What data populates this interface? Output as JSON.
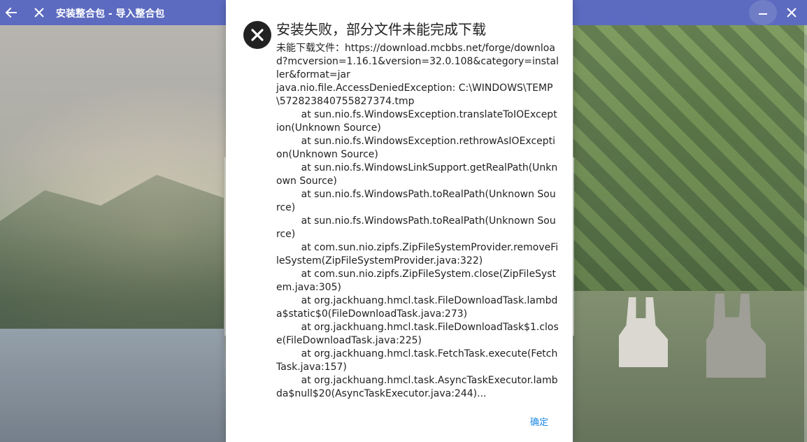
{
  "window": {
    "title": "安装整合包 - 导入整合包",
    "back_icon": "back-arrow-icon",
    "close_nav_icon": "close-icon",
    "minimize_glyph": "–",
    "close_glyph": "✕",
    "accent": "#5c6bc0"
  },
  "dialog": {
    "icon": "error-icon",
    "title": "安装失败，部分文件未能完成下载",
    "message": "未能下载文件：https://download.mcbbs.net/forge/download?mcversion=1.16.1&version=32.0.108&category=installer&format=jar\njava.nio.file.AccessDeniedException: C:\\WINDOWS\\TEMP\\572823840755827374.tmp\n        at sun.nio.fs.WindowsException.translateToIOException(Unknown Source)\n        at sun.nio.fs.WindowsException.rethrowAsIOException(Unknown Source)\n        at sun.nio.fs.WindowsLinkSupport.getRealPath(Unknown Source)\n        at sun.nio.fs.WindowsPath.toRealPath(Unknown Source)\n        at sun.nio.fs.WindowsPath.toRealPath(Unknown Source)\n        at com.sun.nio.zipfs.ZipFileSystemProvider.removeFileSystem(ZipFileSystemProvider.java:322)\n        at com.sun.nio.zipfs.ZipFileSystem.close(ZipFileSystem.java:305)\n        at org.jackhuang.hmcl.task.FileDownloadTask.lambda$static$0(FileDownloadTask.java:273)\n        at org.jackhuang.hmcl.task.FileDownloadTask$1.close(FileDownloadTask.java:225)\n        at org.jackhuang.hmcl.task.FetchTask.execute(FetchTask.java:157)\n        at org.jackhuang.hmcl.task.AsyncTaskExecutor.lambda$null$20(AsyncTaskExecutor.java:244)...",
    "ok_label": "确定",
    "ok_color": "#1e88e5"
  }
}
